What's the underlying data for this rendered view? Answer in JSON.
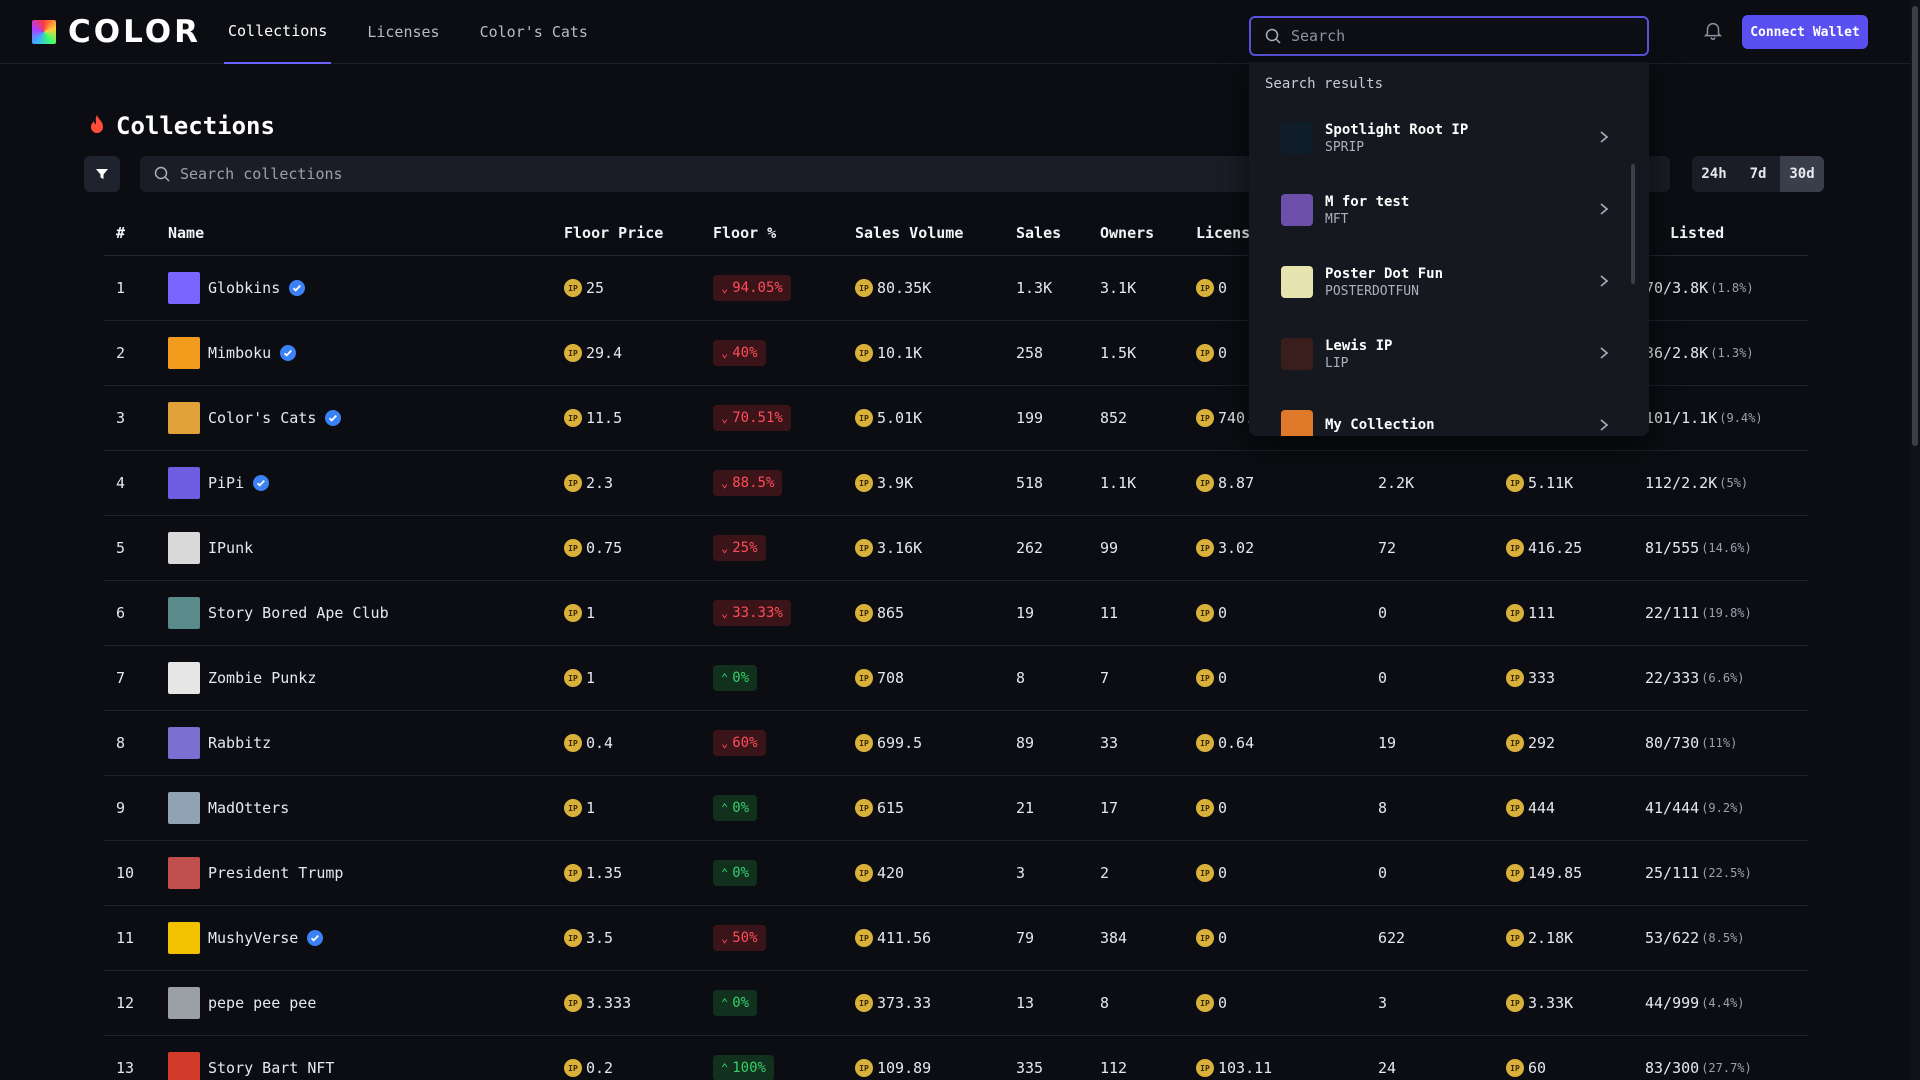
{
  "header": {
    "logo": "COLOR",
    "nav": [
      "Collections",
      "Licenses",
      "Color's Cats"
    ],
    "search_placeholder": "Search",
    "connect_label": "Connect Wallet"
  },
  "page": {
    "title": "Collections",
    "search_placeholder": "Search collections",
    "periods": [
      "24h",
      "7d",
      "30d"
    ],
    "selected_period": "30d"
  },
  "table": {
    "columns": [
      "#",
      "Name",
      "Floor Price",
      "Floor %",
      "Sales Volume",
      "Sales",
      "Owners",
      "License",
      "",
      "",
      "Listed"
    ],
    "rows": [
      {
        "rank": "1",
        "name": "Globkins",
        "verified": true,
        "floor": "25",
        "pct": "94.05%",
        "dir": "down",
        "volume": "80.35K",
        "sales": "1.3K",
        "owners": "3.1K",
        "license": "0",
        "col9": "",
        "col10": "",
        "listed": "70/3.8K",
        "listed_pct": "(1.8%)",
        "color": "#7a63ff"
      },
      {
        "rank": "2",
        "name": "Mimboku",
        "verified": true,
        "floor": "29.4",
        "pct": "40%",
        "dir": "down",
        "volume": "10.1K",
        "sales": "258",
        "owners": "1.5K",
        "license": "0",
        "col9": "",
        "col10": "",
        "listed": "36/2.8K",
        "listed_pct": "(1.3%)",
        "color": "#f29b1d"
      },
      {
        "rank": "3",
        "name": "Color's Cats",
        "verified": true,
        "floor": "11.5",
        "pct": "70.51%",
        "dir": "down",
        "volume": "5.01K",
        "sales": "199",
        "owners": "852",
        "license": "740.",
        "col9": "",
        "col10": "",
        "listed": "101/1.1K",
        "listed_pct": "(9.4%)",
        "color": "#e2a23a"
      },
      {
        "rank": "4",
        "name": "PiPi",
        "verified": true,
        "floor": "2.3",
        "pct": "88.5%",
        "dir": "down",
        "volume": "3.9K",
        "sales": "518",
        "owners": "1.1K",
        "license": "8.87",
        "col9": "2.2K",
        "col10": "5.11K",
        "listed": "112/2.2K",
        "listed_pct": "(5%)",
        "color": "#6f5ce0"
      },
      {
        "rank": "5",
        "name": "IPunk",
        "verified": false,
        "floor": "0.75",
        "pct": "25%",
        "dir": "down",
        "volume": "3.16K",
        "sales": "262",
        "owners": "99",
        "license": "3.02",
        "col9": "72",
        "col10": "416.25",
        "listed": "81/555",
        "listed_pct": "(14.6%)",
        "color": "#d9d9d9"
      },
      {
        "rank": "6",
        "name": "Story Bored Ape Club",
        "verified": false,
        "floor": "1",
        "pct": "33.33%",
        "dir": "down",
        "volume": "865",
        "sales": "19",
        "owners": "11",
        "license": "0",
        "col9": "0",
        "col10": "111",
        "listed": "22/111",
        "listed_pct": "(19.8%)",
        "color": "#5b8a8a"
      },
      {
        "rank": "7",
        "name": "Zombie Punkz",
        "verified": false,
        "floor": "1",
        "pct": "0%",
        "dir": "up",
        "volume": "708",
        "sales": "8",
        "owners": "7",
        "license": "0",
        "col9": "0",
        "col10": "333",
        "listed": "22/333",
        "listed_pct": "(6.6%)",
        "color": "#e6e6e6"
      },
      {
        "rank": "8",
        "name": "Rabbitz",
        "verified": false,
        "floor": "0.4",
        "pct": "60%",
        "dir": "down",
        "volume": "699.5",
        "sales": "89",
        "owners": "33",
        "license": "0.64",
        "col9": "19",
        "col10": "292",
        "listed": "80/730",
        "listed_pct": "(11%)",
        "color": "#7d6fd1"
      },
      {
        "rank": "9",
        "name": "MadOtters",
        "verified": false,
        "floor": "1",
        "pct": "0%",
        "dir": "up",
        "volume": "615",
        "sales": "21",
        "owners": "17",
        "license": "0",
        "col9": "8",
        "col10": "444",
        "listed": "41/444",
        "listed_pct": "(9.2%)",
        "color": "#8fa3b5"
      },
      {
        "rank": "10",
        "name": "President Trump",
        "verified": false,
        "floor": "1.35",
        "pct": "0%",
        "dir": "up",
        "volume": "420",
        "sales": "3",
        "owners": "2",
        "license": "0",
        "col9": "0",
        "col10": "149.85",
        "listed": "25/111",
        "listed_pct": "(22.5%)",
        "color": "#c0504d"
      },
      {
        "rank": "11",
        "name": "MushyVerse",
        "verified": true,
        "floor": "3.5",
        "pct": "50%",
        "dir": "down",
        "volume": "411.56",
        "sales": "79",
        "owners": "384",
        "license": "0",
        "col9": "622",
        "col10": "2.18K",
        "listed": "53/622",
        "listed_pct": "(8.5%)",
        "color": "#f2c200"
      },
      {
        "rank": "12",
        "name": "pepe pee pee",
        "verified": false,
        "floor": "3.333",
        "pct": "0%",
        "dir": "up",
        "volume": "373.33",
        "sales": "13",
        "owners": "8",
        "license": "0",
        "col9": "3",
        "col10": "3.33K",
        "listed": "44/999",
        "listed_pct": "(4.4%)",
        "color": "#9aa0a6"
      },
      {
        "rank": "13",
        "name": "Story Bart NFT",
        "verified": false,
        "floor": "0.2",
        "pct": "100%",
        "dir": "up",
        "volume": "109.89",
        "sales": "335",
        "owners": "112",
        "license": "103.11",
        "col9": "24",
        "col10": "60",
        "listed": "83/300",
        "listed_pct": "(27.7%)",
        "color": "#d23a2a"
      }
    ]
  },
  "dropdown": {
    "title": "Search results",
    "items": [
      {
        "name": "Spotlight Root IP",
        "symbol": "SPRIP",
        "color": "#0f1d2a"
      },
      {
        "name": "M for test",
        "symbol": "MFT",
        "color": "#6b4fa8"
      },
      {
        "name": "Poster Dot Fun",
        "symbol": "POSTERDOTFUN",
        "color": "#e8e4b0"
      },
      {
        "name": "Lewis IP",
        "symbol": "LIP",
        "color": "#3a1d1d"
      },
      {
        "name": "My Collection",
        "symbol": "",
        "color": "#e07a2a"
      }
    ]
  }
}
